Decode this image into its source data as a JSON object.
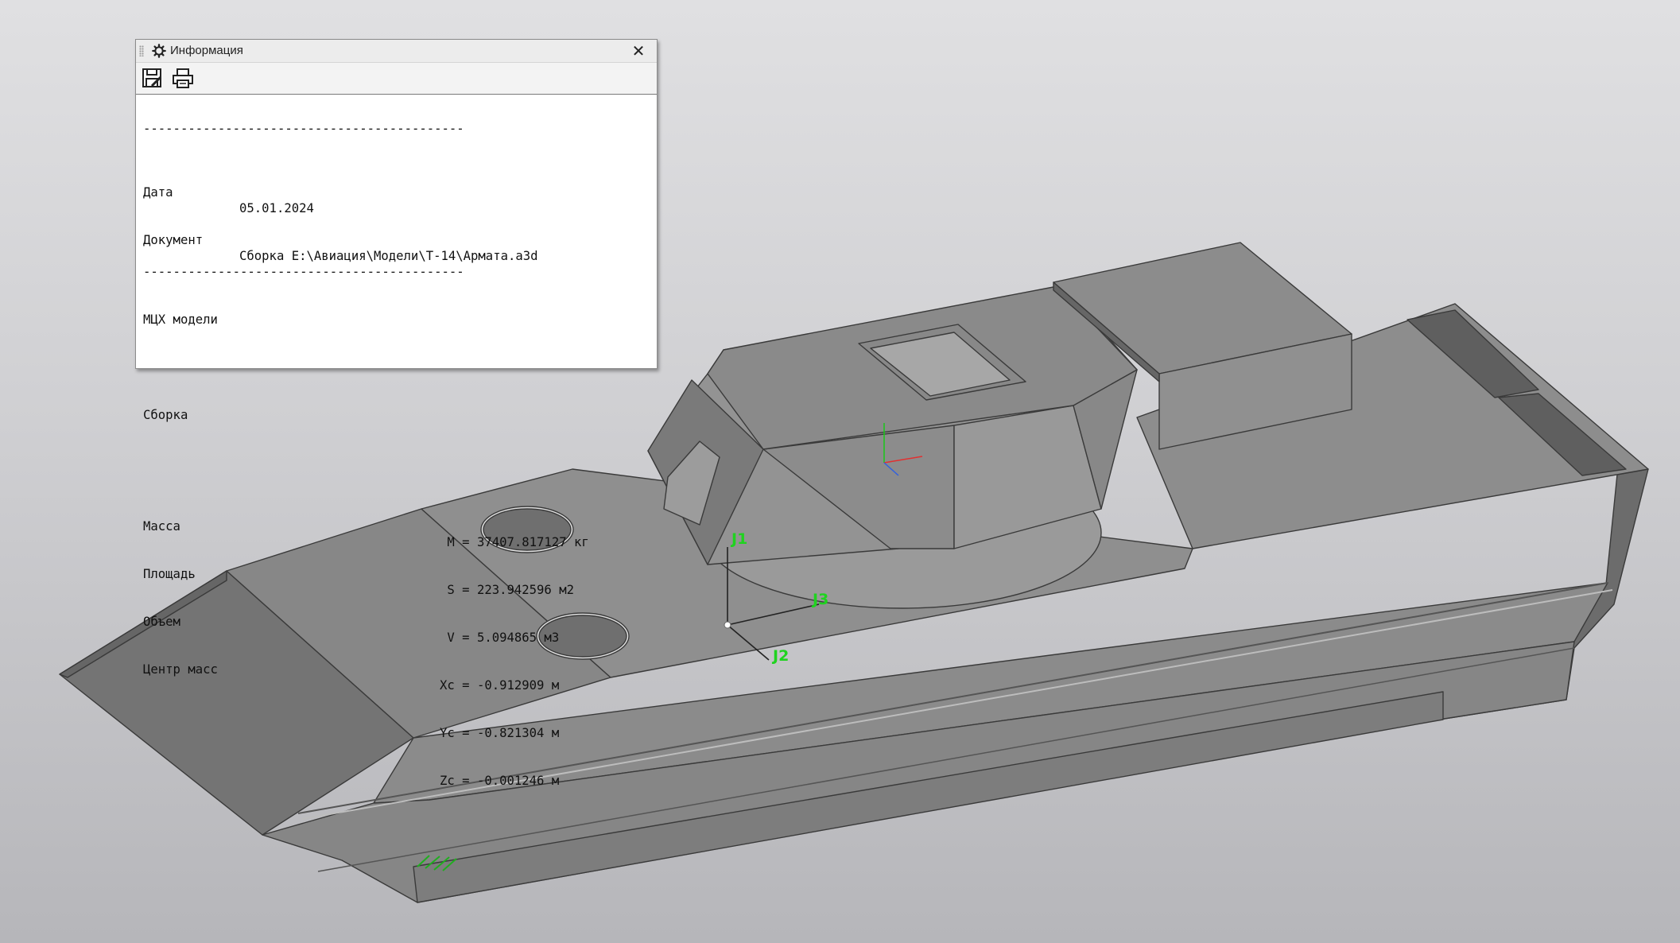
{
  "window": {
    "title": "Информация",
    "close_symbol": "✕",
    "toolbar": [
      {
        "icon": "save-icon",
        "tooltip_visible": false
      },
      {
        "icon": "print-icon",
        "tooltip_visible": false
      }
    ]
  },
  "report": {
    "separator": "-------------------------------------------",
    "date_label": "Дата",
    "date_value": "05.01.2024",
    "document_label": "Документ",
    "document_value": "Сборка E:\\Авиация\\Модели\\Т-14\\Армата.a3d",
    "section_title": "МЦХ модели",
    "object_type": "Сборка",
    "properties": [
      {
        "label": "Масса",
        "value": " M = 37407.817127 кг"
      },
      {
        "label": "Площадь",
        "value": " S = 223.942596 м2"
      },
      {
        "label": "Объем",
        "value": " V = 5.094865 м3"
      },
      {
        "label": "Центр масс",
        "value": "Xc = -0.912909 м"
      },
      {
        "label": "",
        "value": "Yc = -0.821304 м"
      },
      {
        "label": "",
        "value": "Zc = -0.001246 м"
      }
    ]
  },
  "viewport": {
    "joint_labels": [
      "J1",
      "J2",
      "J3"
    ],
    "colors": {
      "background_top": "#e0e0e2",
      "background_bottom": "#b6b6ba",
      "model_faces": "#8a8a8a",
      "axis_labels": "#1fd31f"
    }
  }
}
